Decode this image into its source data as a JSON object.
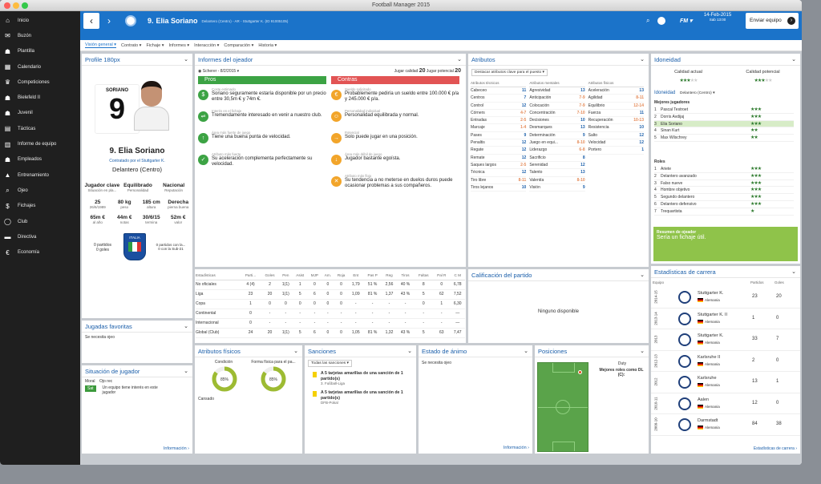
{
  "window": {
    "title": "Football Manager 2015"
  },
  "sidebar": {
    "items": [
      {
        "label": "Inicio",
        "icon": "home-icon",
        "glyph": "⌂"
      },
      {
        "label": "Buzón",
        "icon": "inbox-icon",
        "glyph": "✉"
      },
      {
        "label": "Plantilla",
        "icon": "squad-icon",
        "glyph": "☗"
      },
      {
        "label": "Calendario",
        "icon": "calendar-icon",
        "glyph": "▦"
      },
      {
        "label": "Competiciones",
        "icon": "trophy-icon",
        "glyph": "♛"
      },
      {
        "label": "Bielefeld II",
        "icon": "team-icon",
        "glyph": "☗"
      },
      {
        "label": "Juvenil",
        "icon": "youth-icon",
        "glyph": "☗"
      },
      {
        "label": "Tácticas",
        "icon": "tactics-icon",
        "glyph": "▤"
      },
      {
        "label": "Informe de equipo",
        "icon": "report-icon",
        "glyph": "▥"
      },
      {
        "label": "Empleados",
        "icon": "staff-icon",
        "glyph": "☗"
      },
      {
        "label": "Entrenamiento",
        "icon": "training-icon",
        "glyph": "▲"
      },
      {
        "label": "Ojeo",
        "icon": "scouting-icon",
        "glyph": "⌕"
      },
      {
        "label": "Fichajes",
        "icon": "transfers-icon",
        "glyph": "$"
      },
      {
        "label": "Club",
        "icon": "club-icon",
        "glyph": "◯"
      },
      {
        "label": "Directiva",
        "icon": "board-icon",
        "glyph": "▬"
      },
      {
        "label": "Economía",
        "icon": "finance-icon",
        "glyph": "€"
      }
    ]
  },
  "header": {
    "number": "9.",
    "name": "Elia Soriano",
    "detail": "Delantero (Centro) - AR - Stuttgarter K. (ID 91005105)",
    "date": "14-Feb-2015",
    "day": "Sab 13:00",
    "continue": "Enviar equipo"
  },
  "subnav": [
    "Visión general ▾",
    "Contrato ▾",
    "Fichaje ▾",
    "Informes ▾",
    "Interacción ▾",
    "Comparación ▾",
    "Historia ▾"
  ],
  "profile": {
    "title": "Profile 180px",
    "shirt_name": "SORIANO",
    "shirt_number": "9",
    "full_name": "9. Elia Soriano",
    "contract": "Contratado por el Stuttgarter K.",
    "position": "Delantero (Centro)",
    "traits": [
      {
        "v": "Jugador clave",
        "l": "Situación en pla..."
      },
      {
        "v": "Equilibrado",
        "l": "Personalidad"
      },
      {
        "v": "Nacional",
        "l": "Reputación"
      }
    ],
    "physical": [
      {
        "v": "25",
        "l": "26/6/1989"
      },
      {
        "v": "80 kg",
        "l": "peso"
      },
      {
        "v": "185 cm",
        "l": "altura"
      },
      {
        "v": "Derecha",
        "l": "pierna buena"
      }
    ],
    "money": [
      {
        "v": "65m €",
        "l": "al año"
      },
      {
        "v": "44m €",
        "l": "notas"
      },
      {
        "v": "30/6/15",
        "l": "termina"
      },
      {
        "v": "52m €",
        "l": "valor"
      }
    ],
    "intl_left": [
      "0 partidos",
      "0 goles"
    ],
    "country": "ITALIA",
    "intl_right": [
      "0 partidos con la...",
      "0 con la Sub-21"
    ]
  },
  "favs": {
    "title": "Jugadas favoritas",
    "text": "Se necesita ojeo"
  },
  "situation": {
    "title": "Situación de jugador",
    "moral_label": "Moral",
    "moral_val": "Ojo rec",
    "badge": "Sat",
    "interest": "Un equipo tiene interés en este jugador",
    "link": "Información ›"
  },
  "scout": {
    "title": "Informes del ojeador",
    "scout_name": "Scherer - 8/2/2015 ▾",
    "current_lbl": "Jugar calidad",
    "current": "20",
    "pot_lbl": "Jugar potencial",
    "pot": "20",
    "pros_title": "Pros",
    "cons_title": "Contras",
    "pros": [
      {
        "cap": "Coste estimado",
        "text": "Soriano seguramente estaría disponible por un precio entre 30,5m € y 74m €.",
        "icon": "$"
      },
      {
        "cap": "Interés en el fichaje",
        "text": "Tremendamente interesado en venir a nuestro club.",
        "icon": "⇌"
      },
      {
        "cap": "Área más fuerte de juego",
        "text": "Tiene una buena punta de velocidad.",
        "icon": "↑"
      },
      {
        "cap": "Atributo más fuerte",
        "text": "Su aceleración complementa perfectamente su velocidad.",
        "icon": "✓"
      }
    ],
    "cons": [
      {
        "cap": "Sueldo solicitado",
        "text": "Probablemente pediría un sueldo entre 100.000 € p/a y 245.000 € p/a.",
        "icon": "€"
      },
      {
        "cap": "Personalidad individual",
        "text": "Personalidad equilibrada y normal.",
        "icon": "☺"
      },
      {
        "cap": "Potencial",
        "text": "Solo puede jugar en una posición.",
        "icon": "→"
      },
      {
        "cap": "Área más débil de juego",
        "text": "Jugador bastante egoísta.",
        "icon": "↓"
      },
      {
        "cap": "Atributo más flojo",
        "text": "Su tendencia a no meterse en duelos duros puede ocasionar problemas a sus compañeros.",
        "icon": "✕"
      }
    ]
  },
  "stats": {
    "headers": [
      "Estadísticas",
      "Parti...",
      "Goles",
      "Pen",
      "Asist",
      "MJP",
      "Am.",
      "Roja",
      "Ent",
      "Pas P",
      "Reg",
      "Tiros",
      "Faltas",
      "Pal R",
      "C M"
    ],
    "rows": [
      [
        "No oficiales",
        "4 (4)",
        "2",
        "1(1)",
        "1",
        "0",
        "0",
        "0",
        "1,79",
        "51 %",
        "2,56",
        "40 %",
        "8",
        "0",
        "6,78"
      ],
      [
        "Liga",
        "23",
        "20",
        "1(1)",
        "5",
        "6",
        "0",
        "0",
        "1,09",
        "81 %",
        "1,37",
        "43 %",
        "5",
        "62",
        "7,52"
      ],
      [
        "Copa",
        "1",
        "0",
        "0",
        "0",
        "0",
        "0",
        "0",
        "-",
        "-",
        "-",
        "-",
        "0",
        "1",
        "6,30"
      ],
      [
        "Continental",
        "0",
        "-",
        "-",
        "-",
        "-",
        "-",
        "-",
        "-",
        "-",
        "-",
        "-",
        "-",
        "-",
        "—"
      ],
      [
        "Internacional",
        "0",
        "-",
        "-",
        "-",
        "-",
        "-",
        "-",
        "-",
        "-",
        "-",
        "-",
        "-",
        "-",
        "—"
      ],
      [
        "Global (Club)",
        "24",
        "20",
        "1(1)",
        "5",
        "6",
        "0",
        "0",
        "1,05",
        "81 %",
        "1,32",
        "43 %",
        "5",
        "63",
        "7,47"
      ]
    ]
  },
  "attributes": {
    "title": "Atributos",
    "filter": "Destacar atributos clave para el puesto ▾",
    "col_titles": [
      "Atributos técnicos",
      "Atributos mentales",
      "Atributos físicos"
    ],
    "tech": [
      [
        "Cabeceo",
        "11"
      ],
      [
        "Centros",
        "7"
      ],
      [
        "Control",
        "12"
      ],
      [
        "Córners",
        "4-7"
      ],
      [
        "Entradas",
        "2-5"
      ],
      [
        "Marcaje",
        "1-4"
      ],
      [
        "Pases",
        "9"
      ],
      [
        "Penaltis",
        "12"
      ],
      [
        "Regate",
        "12"
      ],
      [
        "Remate",
        "12"
      ],
      [
        "Saques largos",
        "2-5"
      ],
      [
        "Técnica",
        "12"
      ],
      [
        "Tiro libre",
        "8-11"
      ],
      [
        "Tiros lejanos",
        "10"
      ]
    ],
    "ment": [
      [
        "Agresividad",
        "13"
      ],
      [
        "Anticipación",
        "7-9"
      ],
      [
        "Colocación",
        "7-9"
      ],
      [
        "Concentración",
        "7-10"
      ],
      [
        "Decisiones",
        "10"
      ],
      [
        "Desmarques",
        "13"
      ],
      [
        "Determinación",
        "9"
      ],
      [
        "Juego en equi...",
        "8-10"
      ],
      [
        "Liderazgo",
        "6-8"
      ],
      [
        "Sacrificio",
        "8"
      ],
      [
        "Serenidad",
        "12"
      ],
      [
        "Talento",
        "13"
      ],
      [
        "Valentía",
        "8-10"
      ],
      [
        "Visión",
        "9"
      ]
    ],
    "phys": [
      [
        "Aceleración",
        "13"
      ],
      [
        "Agilidad",
        "8-11"
      ],
      [
        "Equilibrio",
        "12-14"
      ],
      [
        "Fuerza",
        "11"
      ],
      [
        "Recuperación",
        "10-13"
      ],
      [
        "Resistencia",
        "10"
      ],
      [
        "Salto",
        "12"
      ],
      [
        "Velocidad",
        "12"
      ],
      [
        "Portero",
        "1"
      ]
    ]
  },
  "ideon": {
    "title": "Idoneidad",
    "cur_lbl": "Calidad actual",
    "pot_lbl": "Calidad potencial",
    "sub": "Idoneidad",
    "pos": "Delantero (Centro) ▾",
    "best": "Mejores jugadores",
    "players": [
      [
        "1",
        "Pascal Testroet",
        "★★★"
      ],
      [
        "2",
        "Dorris Avdijaj",
        "★★★"
      ],
      [
        "3",
        "Elia Soriano",
        "★★★"
      ],
      [
        "4",
        "Sinan Kurt",
        "★★"
      ],
      [
        "5",
        "Max Wilschrey",
        "★★"
      ]
    ],
    "roles_title": "Roles",
    "roles": [
      [
        "1",
        "Ariete",
        "★★★"
      ],
      [
        "2",
        "Delantero avanzado",
        "★★★"
      ],
      [
        "3",
        "Falso nueve",
        "★★★"
      ],
      [
        "4",
        "Hombre objetivo",
        "★★★"
      ],
      [
        "5",
        "Segundo delantero",
        "★★★"
      ],
      [
        "6",
        "Delantero defensivo",
        "★★★"
      ],
      [
        "7",
        "Trequartista",
        "★"
      ]
    ],
    "summary_title": "Resumen de ojeador",
    "summary": "Sería un fichaje útil."
  },
  "match": {
    "title": "Calificación del partido",
    "empty": "Ninguno disponible"
  },
  "career": {
    "title": "Estadísticas de carrera",
    "col_team": "Equipo",
    "col_apps": "Partidos",
    "col_goals": "Goles",
    "link": "Estadísticas de carrera ›",
    "rows": [
      {
        "year": "2014-15",
        "team": "Stuttgarter K.",
        "country": "Alemania",
        "apps": "23",
        "goals": "20"
      },
      {
        "year": "2013-14",
        "team": "Stuttgarter K. II",
        "country": "Alemania",
        "apps": "1",
        "goals": "0"
      },
      {
        "year": "2013",
        "team": "Stuttgarter K.",
        "country": "Alemania",
        "apps": "33",
        "goals": "7"
      },
      {
        "year": "2012-13",
        "team": "Karlsruhe II",
        "country": "Alemania",
        "apps": "2",
        "goals": "0"
      },
      {
        "year": "2012",
        "team": "Karlsruhe",
        "country": "Alemania",
        "apps": "13",
        "goals": "1"
      },
      {
        "year": "2010-11",
        "team": "Aalen",
        "country": "Alemania",
        "apps": "12",
        "goals": "0"
      },
      {
        "year": "2009-10",
        "team": "Darmstadt",
        "country": "Alemania",
        "apps": "84",
        "goals": "38"
      }
    ]
  },
  "physattr": {
    "title": "Atributos físicos",
    "c1": "Condición",
    "c2": "Forma física para el pa...",
    "p1": "85%",
    "p2": "85%",
    "v1": 0.85,
    "v2": 0.85,
    "tired": "Cansado"
  },
  "sanctions": {
    "title": "Sanciones",
    "filter": "Todas las sanciones ▾",
    "items": [
      {
        "text": "A 5 tarjetas amarillas de una sanción de 1 partido(s)",
        "sub": "3. Fußball-Liga"
      },
      {
        "text": "A 5 tarjetas amarillas de una sanción de 1 partido(s)",
        "sub": "DFB-Pokal"
      }
    ]
  },
  "mood": {
    "title": "Estado de ánimo",
    "text": "Se necesita ojeo",
    "link": "Información ›"
  },
  "positions": {
    "title": "Posiciones",
    "duty": "Duty",
    "best_role": "Mejores roles como DL (C):"
  }
}
